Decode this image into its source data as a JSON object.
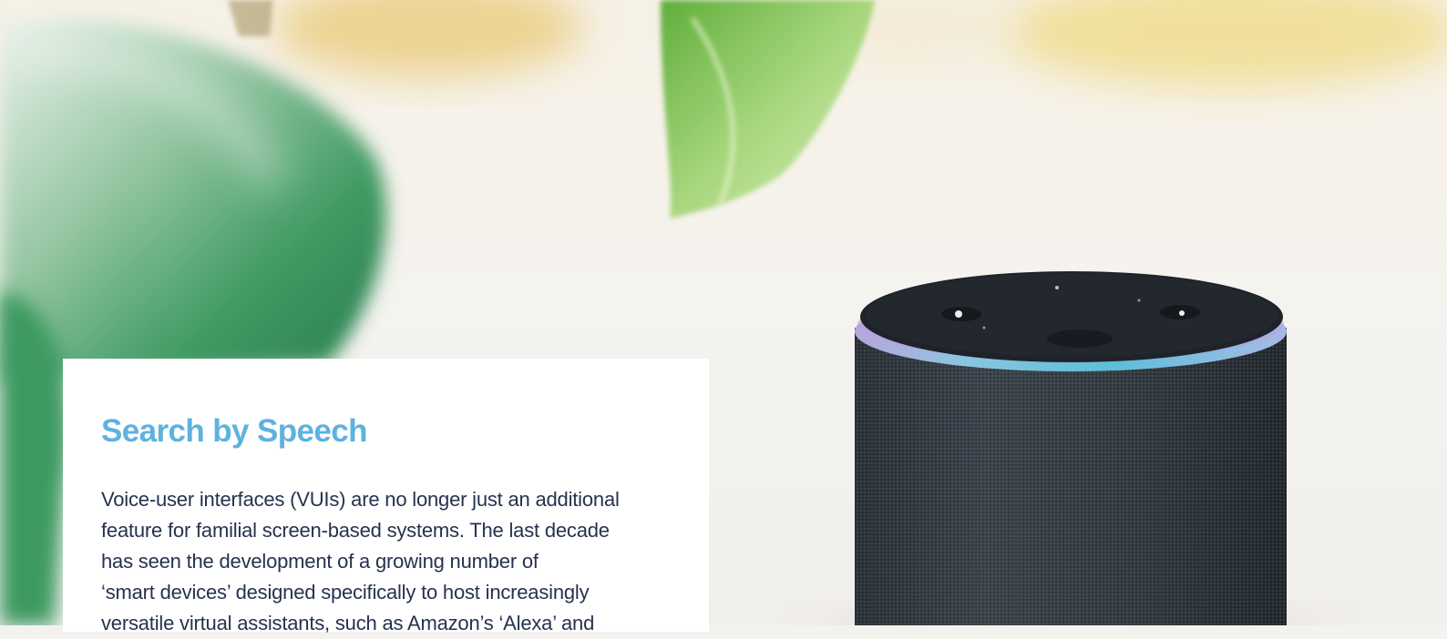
{
  "article": {
    "heading": "Search by Speech",
    "body_lines": [
      "Voice-user interfaces (VUIs) are no longer just an additional",
      "feature for familial screen-based systems. The last decade",
      "has seen the development of a growing number of",
      "‘smart devices’ designed specifically to host increasingly",
      "versatile virtual assistants, such as Amazon’s ‘Alexa’ and"
    ]
  },
  "colors": {
    "heading": "#5fb2df",
    "body_text": "#26324f",
    "card_background": "#ffffff",
    "speaker_ring": "#6fc3dc"
  }
}
